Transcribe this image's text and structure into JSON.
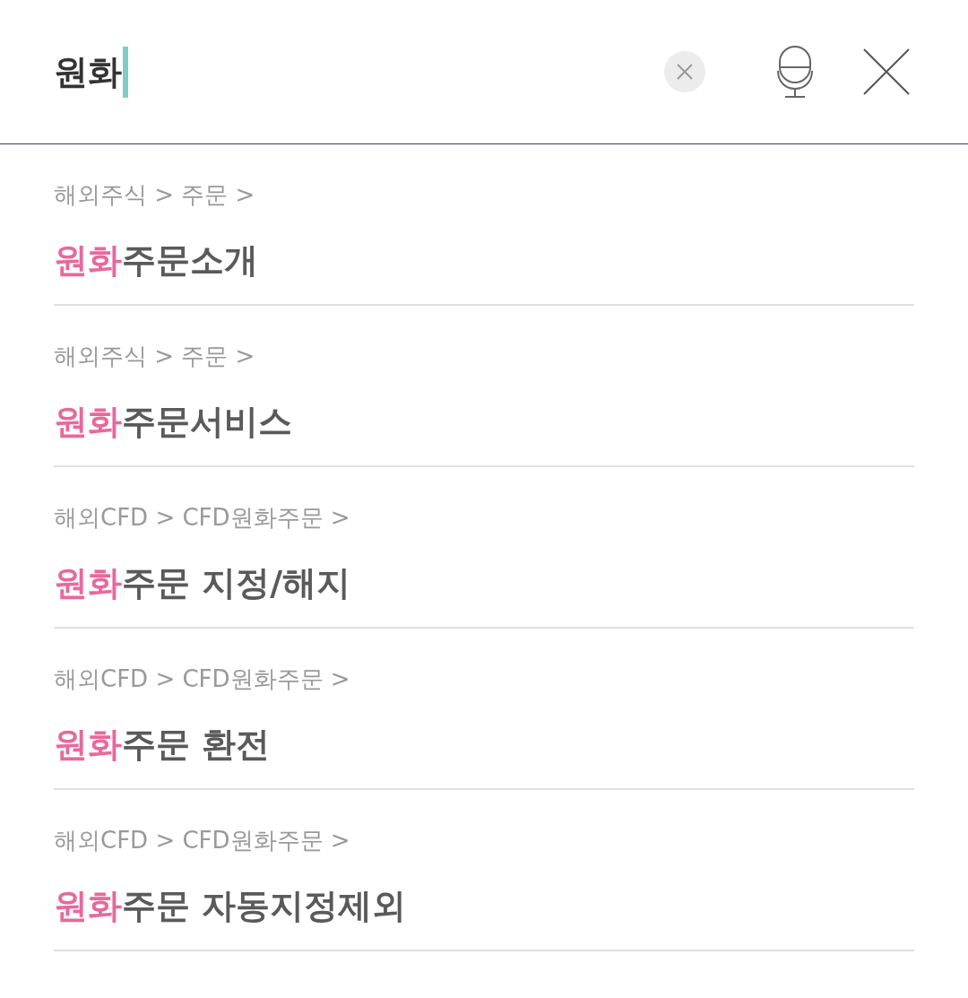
{
  "search": {
    "value": "원화",
    "focused": true
  },
  "results": [
    {
      "path": "해외주식 > 주문 >",
      "title": "**원화**주문소개"
    },
    {
      "path": "해외주식 > 주문 >",
      "title": "**원화**주문서비스"
    },
    {
      "path": "해외CFD > CFD원화주문 >",
      "title": "**원화**주문 지정/해지"
    },
    {
      "path": "해외CFD > CFD원화주문 >",
      "title": "**원화**주문 환전"
    },
    {
      "path": "해외CFD > CFD원화주문 >",
      "title": "**원화**주문 자동지정제외"
    }
  ]
}
